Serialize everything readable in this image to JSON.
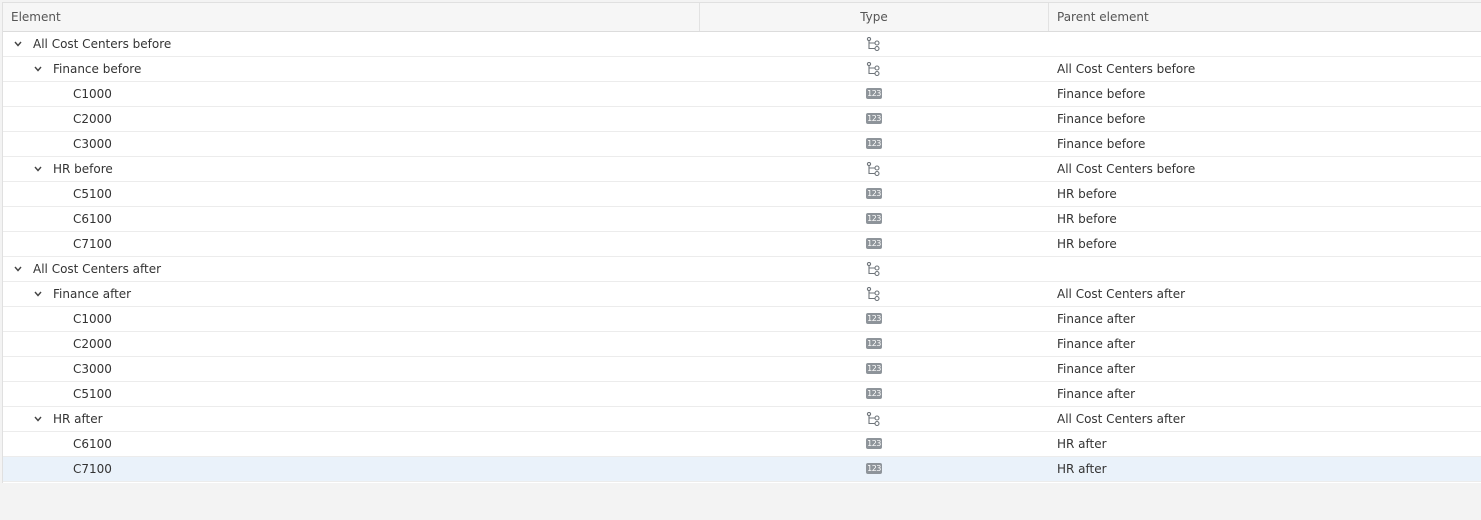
{
  "columns": {
    "element": "Element",
    "type": "Type",
    "parent": "Parent element"
  },
  "icons": {
    "hierarchy": "hierarchy-icon",
    "numeric": "numeric-icon",
    "expand": "chevron-down-icon"
  },
  "numeric_icon_text": "123",
  "rows": [
    {
      "label": "All Cost Centers before",
      "level": 0,
      "expandable": true,
      "type": "hierarchy",
      "parent": ""
    },
    {
      "label": "Finance before",
      "level": 1,
      "expandable": true,
      "type": "hierarchy",
      "parent": "All Cost Centers before"
    },
    {
      "label": "C1000",
      "level": 2,
      "expandable": false,
      "type": "numeric",
      "parent": "Finance before"
    },
    {
      "label": "C2000",
      "level": 2,
      "expandable": false,
      "type": "numeric",
      "parent": "Finance before"
    },
    {
      "label": "C3000",
      "level": 2,
      "expandable": false,
      "type": "numeric",
      "parent": "Finance before"
    },
    {
      "label": "HR before",
      "level": 1,
      "expandable": true,
      "type": "hierarchy",
      "parent": "All Cost Centers before"
    },
    {
      "label": "C5100",
      "level": 2,
      "expandable": false,
      "type": "numeric",
      "parent": "HR before"
    },
    {
      "label": "C6100",
      "level": 2,
      "expandable": false,
      "type": "numeric",
      "parent": "HR before"
    },
    {
      "label": "C7100",
      "level": 2,
      "expandable": false,
      "type": "numeric",
      "parent": "HR before"
    },
    {
      "label": "All Cost Centers after",
      "level": 0,
      "expandable": true,
      "type": "hierarchy",
      "parent": ""
    },
    {
      "label": "Finance after",
      "level": 1,
      "expandable": true,
      "type": "hierarchy",
      "parent": "All Cost Centers after"
    },
    {
      "label": "C1000",
      "level": 2,
      "expandable": false,
      "type": "numeric",
      "parent": "Finance after"
    },
    {
      "label": "C2000",
      "level": 2,
      "expandable": false,
      "type": "numeric",
      "parent": "Finance after"
    },
    {
      "label": "C3000",
      "level": 2,
      "expandable": false,
      "type": "numeric",
      "parent": "Finance after"
    },
    {
      "label": "C5100",
      "level": 2,
      "expandable": false,
      "type": "numeric",
      "parent": "Finance after"
    },
    {
      "label": "HR after",
      "level": 1,
      "expandable": true,
      "type": "hierarchy",
      "parent": "All Cost Centers after"
    },
    {
      "label": "C6100",
      "level": 2,
      "expandable": false,
      "type": "numeric",
      "parent": "HR after"
    },
    {
      "label": "C7100",
      "level": 2,
      "expandable": false,
      "type": "numeric",
      "parent": "HR after",
      "selected": true
    }
  ],
  "colors": {
    "selected_row": "#eaf2fa",
    "numeric_icon_bg": "#8e949a",
    "hierarchy_icon_stroke": "#6f757b"
  }
}
